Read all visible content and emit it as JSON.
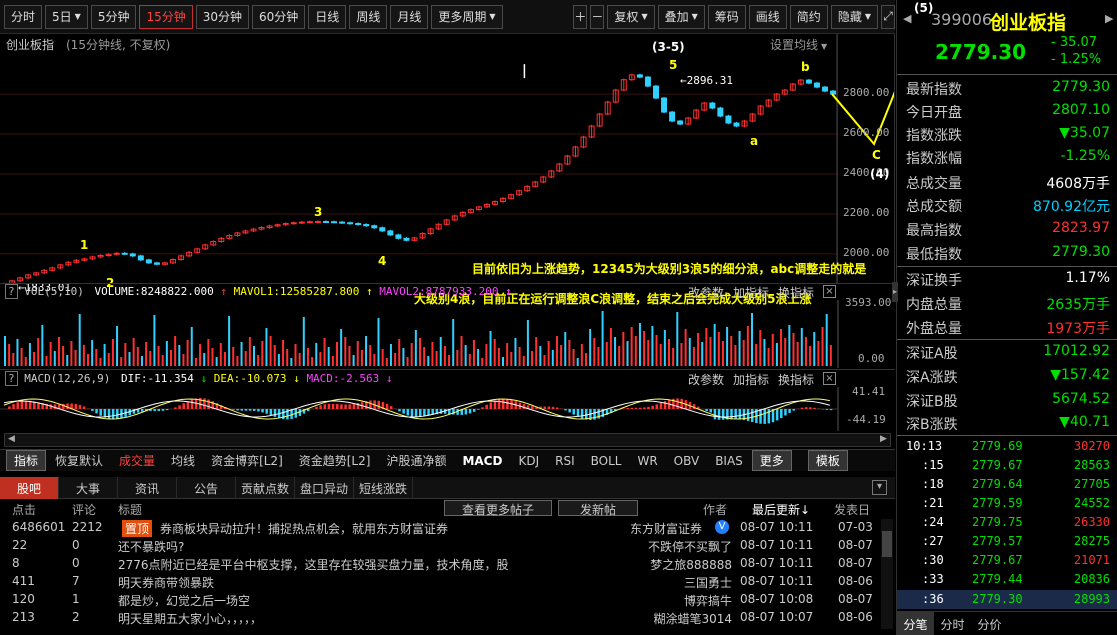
{
  "toolbar": {
    "left": [
      "分时",
      "5日",
      "5分钟",
      "15分钟",
      "30分钟",
      "60分钟",
      "日线",
      "周线",
      "月线",
      "更多周期"
    ],
    "active": "15分钟",
    "right": [
      "复权",
      "叠加",
      "筹码",
      "画线",
      "简约",
      "隐藏"
    ]
  },
  "chart": {
    "title": "创业板指",
    "subtitle": "(15分钟线, 不复权)",
    "set_ma": "设置均线",
    "y_ticks": [
      "2800.00",
      "2600.00",
      "2400.00",
      "2200.00",
      "2000.00"
    ],
    "high_label": "2896.31",
    "low_label": "1833.01",
    "waves": {
      "w1": "1",
      "w2": "2",
      "w3": "3",
      "w4": "4",
      "w5": "5",
      "top": "(3-5)",
      "a": "a",
      "b": "b",
      "c": "C",
      "w4b": "(4)",
      "w5b": "(5)"
    },
    "note1": "目前依旧为上涨趋势，12345为大级别3浪5的细分浪，abc调整走的就是",
    "note2": "大级别4浪，目前正在运行调整浪C浪调整，结束之后会完成大级别5浪上涨",
    "series": [
      1850,
      1865,
      1880,
      1895,
      1905,
      1918,
      1930,
      1945,
      1958,
      1968,
      1975,
      1985,
      1992,
      1998,
      2003,
      2000,
      1990,
      1970,
      1955,
      1948,
      1955,
      1972,
      1990,
      2008,
      2025,
      2045,
      2062,
      2078,
      2092,
      2105,
      2115,
      2124,
      2132,
      2140,
      2146,
      2152,
      2156,
      2159,
      2161,
      2162,
      2161,
      2159,
      2156,
      2152,
      2147,
      2141,
      2131,
      2115,
      2095,
      2078,
      2068,
      2080,
      2102,
      2125,
      2148,
      2170,
      2190,
      2208,
      2222,
      2235,
      2248,
      2262,
      2278,
      2296,
      2316,
      2338,
      2360,
      2385,
      2415,
      2450,
      2490,
      2535,
      2585,
      2640,
      2700,
      2760,
      2820,
      2872,
      2896,
      2885,
      2840,
      2780,
      2710,
      2665,
      2650,
      2680,
      2720,
      2755,
      2730,
      2690,
      2655,
      2640,
      2665,
      2700,
      2740,
      2770,
      2800,
      2820,
      2850,
      2870,
      2855,
      2835,
      2815,
      2800
    ]
  },
  "vol": {
    "label": "VOL(5,10)",
    "volume": "VOLUME:8248822.000",
    "mavol1": "MAVOL1:12585287.800",
    "mavol2": "MAVOL2:8787933.200",
    "top": "3593.00",
    "bottom": "0.00",
    "btns": [
      "改参数",
      "加指标",
      "换指标"
    ]
  },
  "macd": {
    "label": "MACD(12,26,9)",
    "dif": "DIF:-11.354",
    "dea": "DEA:-10.073",
    "macd": "MACD:-2.563",
    "top": "41.41",
    "bottom": "-44.19",
    "btns": [
      "改参数",
      "加指标",
      "换指标"
    ]
  },
  "indtabs": [
    "指标",
    "恢复默认",
    "成交量",
    "均线",
    "资金博弈[L2]",
    "资金趋势[L2]",
    "沪股通净额",
    "MACD",
    "KDJ",
    "RSI",
    "BOLL",
    "WR",
    "OBV",
    "BIAS",
    "更多",
    "模板"
  ],
  "forum": {
    "tabs": [
      "股吧",
      "大事",
      "资讯",
      "公告",
      "贡献点数",
      "盘口异动",
      "短线涨跌"
    ],
    "header": {
      "clicks": "点击",
      "comments": "评论",
      "title": "标题",
      "more": "查看更多帖子",
      "post": "发新帖",
      "author": "作者",
      "updated": "最后更新↓",
      "posted": "发表日"
    },
    "pin": "置顶",
    "rows": [
      {
        "clicks": "6486601",
        "comments": "2212",
        "title": "券商板块异动拉升！捕捉热点机会，就用东方财富证券",
        "author": "东方财富证券",
        "updated": "08-07  10:11",
        "posted": "07-03"
      },
      {
        "clicks": "22",
        "comments": "0",
        "title": "还不暴跌吗?",
        "author": "不跌停不买飘了",
        "updated": "08-07  10:11",
        "posted": "08-07"
      },
      {
        "clicks": "8",
        "comments": "0",
        "title": "2776点附近已经是平台中枢支撑，这里存在较强买盘力量，技术角度，股",
        "author": "梦之旅888888",
        "updated": "08-07  10:11",
        "posted": "08-07"
      },
      {
        "clicks": "411",
        "comments": "7",
        "title": "明天券商带领暴跌",
        "author": "三国勇士",
        "updated": "08-07  10:11",
        "posted": "08-06"
      },
      {
        "clicks": "120",
        "comments": "1",
        "title": "都是炒，幻觉之后一场空",
        "author": "博弈搞牛",
        "updated": "08-07  10:08",
        "posted": "08-07"
      },
      {
        "clicks": "213",
        "comments": "2",
        "title": "明天星期五大家小心，，，，，",
        "author": "糊涂蜡笔3014",
        "updated": "08-07  10:07",
        "posted": "08-06"
      }
    ]
  },
  "quote": {
    "code": "399006",
    "name": "创业板指",
    "price": "2779.30",
    "change": "- 35.07",
    "pct": "- 1.25%",
    "stats": [
      {
        "k": "最新指数",
        "v": "2779.30",
        "c": "green"
      },
      {
        "k": "今日开盘",
        "v": "2807.10",
        "c": "green"
      },
      {
        "k": "指数涨跌",
        "v": "▼35.07",
        "c": "green"
      },
      {
        "k": "指数涨幅",
        "v": "-1.25%",
        "c": "green"
      },
      {
        "k": "总成交量",
        "v": "4608万手",
        "c": "white"
      },
      {
        "k": "总成交额",
        "v": "870.92亿元",
        "c": "cyan"
      },
      {
        "k": "最高指数",
        "v": "2823.97",
        "c": "red"
      },
      {
        "k": "最低指数",
        "v": "2779.30",
        "c": "green"
      },
      {
        "k": "深证换手",
        "v": "1.17%",
        "c": "white"
      },
      {
        "k": "内盘总量",
        "v": "2635万手",
        "c": "green"
      },
      {
        "k": "外盘总量",
        "v": "1973万手",
        "c": "red"
      },
      {
        "k": "深证A股",
        "v": "17012.92",
        "c": "green"
      },
      {
        "k": "深A涨跌",
        "v": "▼157.42",
        "c": "green"
      },
      {
        "k": "深证B股",
        "v": "5674.52",
        "c": "green"
      },
      {
        "k": "深B涨跌",
        "v": "▼40.71",
        "c": "green"
      }
    ],
    "ticks": [
      {
        "t": "10:13",
        "p": "2779.69",
        "v": "30270",
        "vc": "red"
      },
      {
        "t": ":15",
        "p": "2779.67",
        "v": "28563",
        "vc": "green"
      },
      {
        "t": ":18",
        "p": "2779.64",
        "v": "27705",
        "vc": "green"
      },
      {
        "t": ":21",
        "p": "2779.59",
        "v": "24552",
        "vc": "green"
      },
      {
        "t": ":24",
        "p": "2779.75",
        "v": "26330",
        "vc": "red"
      },
      {
        "t": ":27",
        "p": "2779.57",
        "v": "28275",
        "vc": "green"
      },
      {
        "t": ":30",
        "p": "2779.67",
        "v": "21071",
        "vc": "red"
      },
      {
        "t": ":33",
        "p": "2779.44",
        "v": "20836",
        "vc": "green"
      },
      {
        "t": ":36",
        "p": "2779.30",
        "v": "28993",
        "vc": "green"
      }
    ],
    "tabs": [
      "分笔",
      "分时",
      "分价"
    ]
  }
}
